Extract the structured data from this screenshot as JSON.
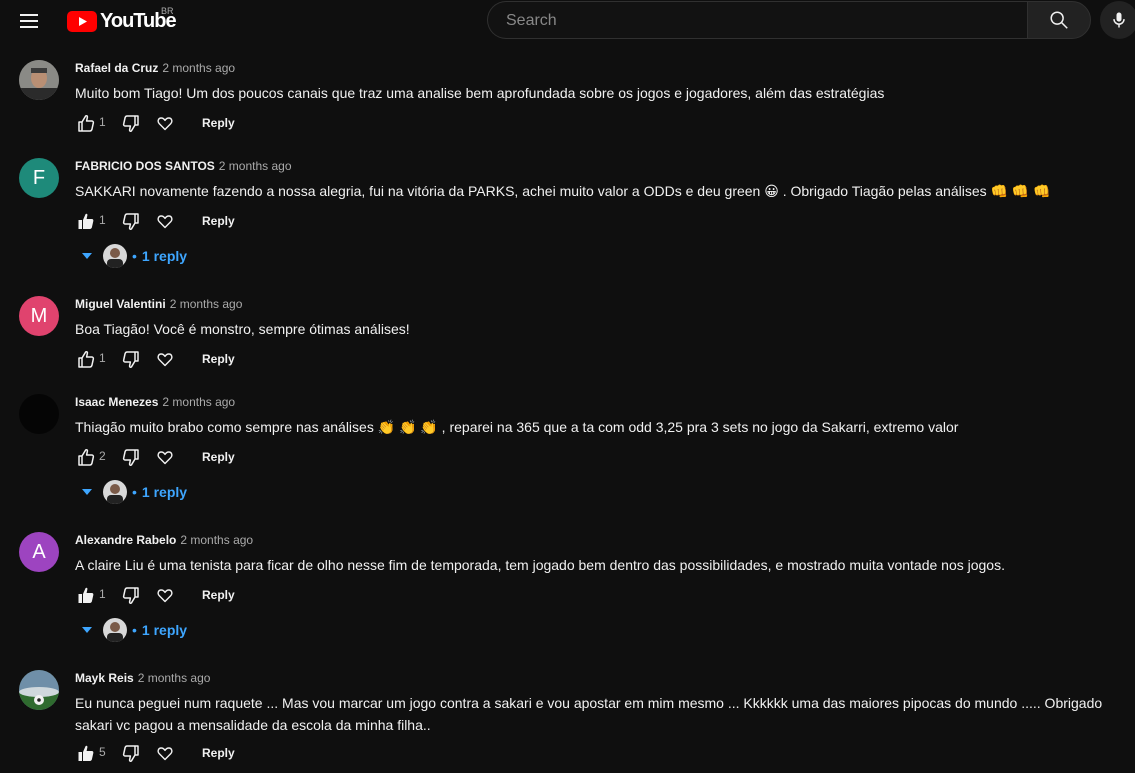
{
  "header": {
    "logo_text": "YouTube",
    "region": "BR",
    "search_placeholder": "Search"
  },
  "comments": [
    {
      "author": "Rafael da Cruz",
      "time": "2 months ago",
      "text": "Muito bom Tiago! Um dos poucos canais que traz uma analise bem aprofundada sobre os jogos e jogadores, além das estratégias",
      "likes": "1",
      "reply_label": "Reply",
      "avatar_icon": "photo-avatar"
    },
    {
      "author": "FABRICIO DOS SANTOS",
      "time": "2 months ago",
      "text": "SAKKARI novamente fazendo a nossa alegria, fui na vitória da PARKS, achei muito valor a ODDs e deu green 😀 . Obrigado Tiagão pelas análises 👊 👊 👊",
      "likes": "1",
      "reply_label": "Reply",
      "avatar_letter": "F",
      "avatar_color": "#1e8a7a",
      "replies_label": "1 reply"
    },
    {
      "author": "Miguel Valentini",
      "time": "2 months ago",
      "text": "Boa Tiagão! Você é monstro, sempre ótimas análises!",
      "likes": "1",
      "reply_label": "Reply",
      "avatar_letter": "M",
      "avatar_color": "#e0436e"
    },
    {
      "author": "Isaac Menezes",
      "time": "2 months ago",
      "text": "Thiagão muito brabo como sempre nas análises 👏 👏 👏 , reparei na 365 que a ta com odd 3,25 pra 3 sets no jogo da Sakarri, extremo valor",
      "likes": "2",
      "reply_label": "Reply",
      "avatar_color": "#050505",
      "replies_label": "1 reply"
    },
    {
      "author": "Alexandre Rabelo",
      "time": "2 months ago",
      "text": "A claire Liu é uma tenista para ficar de olho nesse fim de temporada, tem jogado bem dentro das possibilidades, e mostrado muita vontade nos jogos.",
      "likes": "1",
      "reply_label": "Reply",
      "avatar_letter": "A",
      "avatar_color": "#9d44c0",
      "replies_label": "1 reply"
    },
    {
      "author": "Mayk Reis",
      "time": "2 months ago",
      "text": "Eu nunca peguei num raquete ... Mas vou marcar um jogo contra a sakari e vou apostar em mim mesmo ... Kkkkkk uma das maiores pipocas do mundo ..... Obrigado sakari vc pagou a mensalidade da escola da minha filha..",
      "likes": "5",
      "reply_label": "Reply",
      "avatar_icon": "stadium-avatar"
    }
  ],
  "colors": {
    "background": "#0f0f0f",
    "link_blue": "#3ea6ff",
    "muted": "#aaaaaa",
    "logo_red": "#ff0000"
  }
}
